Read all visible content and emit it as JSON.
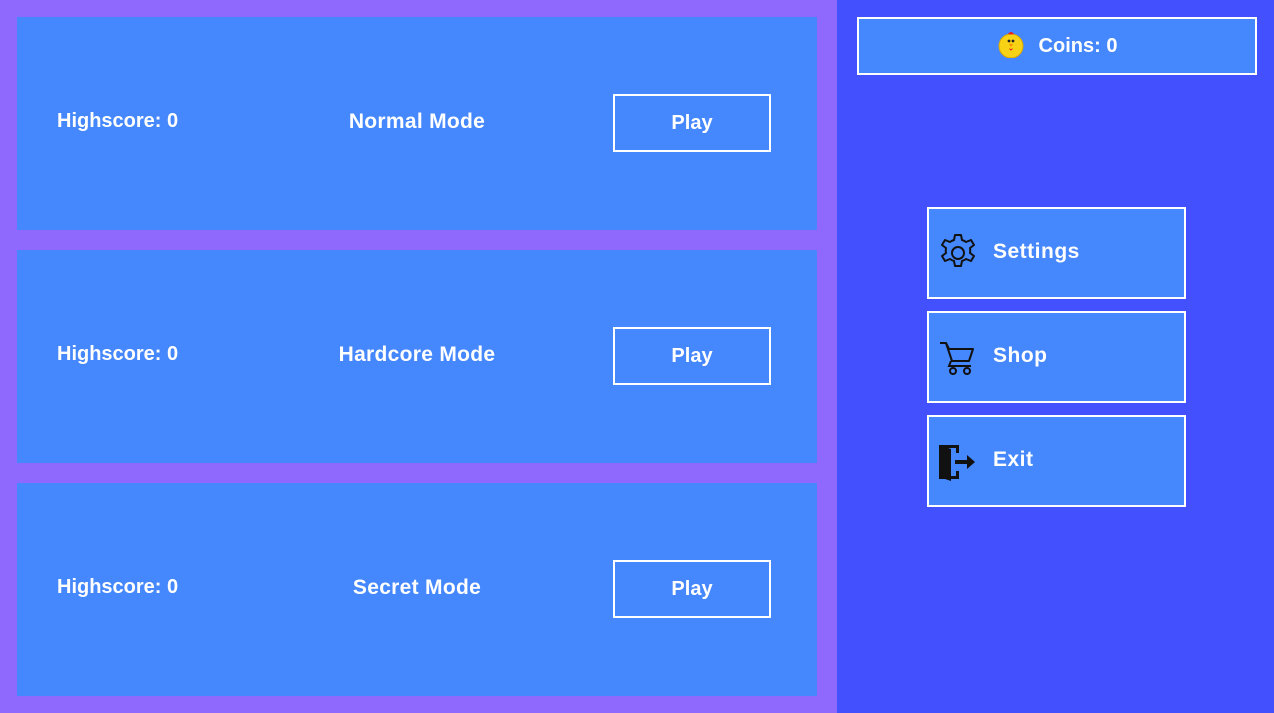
{
  "modes": [
    {
      "highscore": "Highscore: 0",
      "name": "Normal Mode",
      "play_label": "Play"
    },
    {
      "highscore": "Highscore: 0",
      "name": "Hardcore Mode",
      "play_label": "Play"
    },
    {
      "highscore": "Highscore: 0",
      "name": "Secret Mode",
      "play_label": "Play"
    }
  ],
  "coins": {
    "label": "Coins: 0",
    "icon": "chicken-coin-icon"
  },
  "menu": [
    {
      "label": "Settings",
      "icon": "gear-icon"
    },
    {
      "label": "Shop",
      "icon": "cart-icon"
    },
    {
      "label": "Exit",
      "icon": "exit-door-icon"
    }
  ],
  "colors": {
    "background": "#4250fd",
    "panel": "#8f69fd",
    "card": "#4587fd",
    "border": "#ffffff"
  }
}
